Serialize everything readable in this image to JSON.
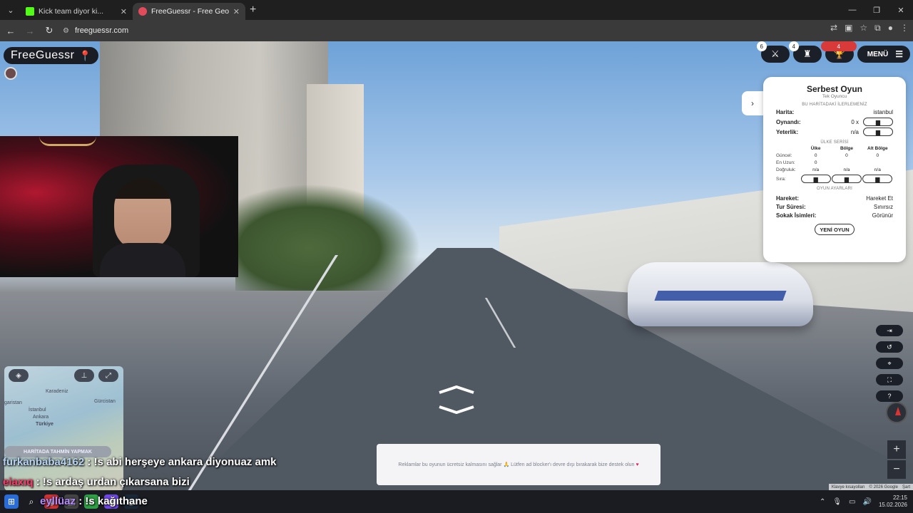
{
  "browser": {
    "tabs": [
      {
        "title": "Kick team diyor ki...",
        "color": "#53fc18"
      },
      {
        "title": "FreeGuessr - Free GeoGuessr Al",
        "color": "#e24b5b"
      }
    ],
    "url": "freeguessr.com"
  },
  "app": {
    "brand": "FreeGuessr",
    "top_badges": [
      "6",
      "4",
      "4"
    ],
    "menu_label": "MENÜ"
  },
  "panel": {
    "title": "Serbest Oyun",
    "subtitle": "Tek Oyuncu",
    "progress_heading": "BU HARİTADAKİ İLERLEMENİZ",
    "map_label": "Harita:",
    "map_value": "istanbul",
    "played_label": "Oynandı:",
    "played_value": "0 x",
    "skill_label": "Yeterlik:",
    "skill_value": "n/a",
    "series_heading": "ÜLKE SERİSİ",
    "cols": [
      "Ülke",
      "Bölge",
      "Alt Bölge"
    ],
    "rows": [
      {
        "label": "Güncel:",
        "values": [
          "0",
          "0",
          "0"
        ]
      },
      {
        "label": "En Uzun:",
        "values": [
          "0",
          "",
          ""
        ]
      },
      {
        "label": "Doğruluk:",
        "values": [
          "n/a",
          "n/a",
          "n/a"
        ]
      },
      {
        "label": "Sıra:",
        "values": [
          "",
          "",
          ""
        ]
      }
    ],
    "settings_heading": "OYUN AYARLARI",
    "move_label": "Hareket:",
    "move_value": "Hareket Et",
    "time_label": "Tur Süresi:",
    "time_value": "Sınırsız",
    "streets_label": "Sokak İsimleri:",
    "streets_value": "Görünür",
    "new_game": "YENİ OYUN"
  },
  "minimap": {
    "labels": [
      "Karadeniz",
      "garistan",
      "İstanbul",
      "Ankara",
      "Türkiye",
      "Gürcistan"
    ],
    "guess_button": "HARİTADA TAHMİN YAPMAK"
  },
  "ad": {
    "text": "Reklamlar bu oyunun ücretsiz kalmasını sağlar 🙏 Lütfen ad blocker'ı devre dışı bırakarak bize destek olun"
  },
  "attribution": [
    "Klavye kısayolları",
    "© 2026 Google",
    "Şart"
  ],
  "chat": [
    {
      "user": "furkanbaba4162",
      "text": ": !s abi herşeye ankara diyonuaz amk"
    },
    {
      "user": "eiaxıq",
      "text": ": !s ardaş urdan çıkarsana bizi"
    },
    {
      "user": "eyllüaz",
      "text": ": !s kağıthane"
    }
  ],
  "taskbar": {
    "time": "22:15",
    "date": "15.02.2026"
  }
}
